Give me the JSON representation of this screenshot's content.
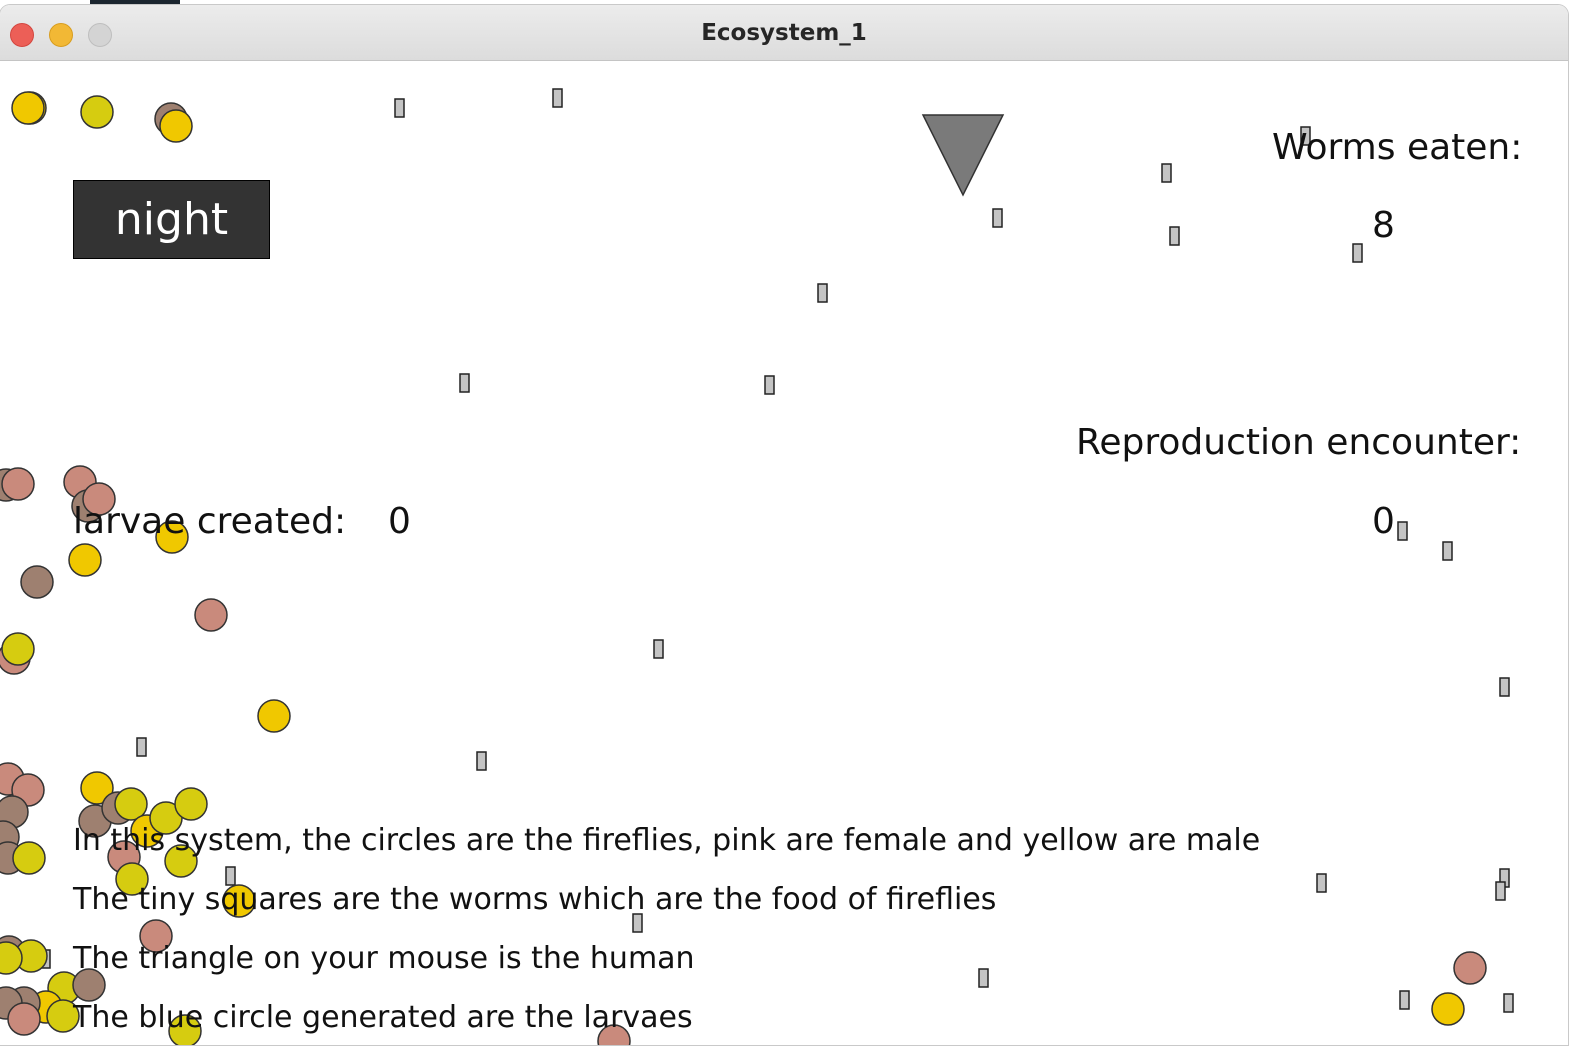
{
  "window": {
    "title": "Ecosystem_1"
  },
  "controls": {
    "mode_button": "night"
  },
  "stats": {
    "worms_label": "Worms eaten:",
    "worms_value": "8",
    "reproduction_label": "Reproduction encounter:",
    "reproduction_value": "0",
    "larvae_label": "larvae created:",
    "larvae_value": "0"
  },
  "info_lines": [
    "In this system, the circles are the fireflies, pink are female and yellow are male",
    "The tiny squares are the worms which are the food of fireflies",
    "The triangle on your mouse is the human",
    "The blue circle generated are the larvaes"
  ],
  "colors": {
    "female": "#c98a7c",
    "male": "#f0c800",
    "male_alt": "#d6cc10",
    "neutral": "#9e8070",
    "worm": "#c4c4c4",
    "human": "#7a7a7a",
    "button_bg": "#333333"
  }
}
